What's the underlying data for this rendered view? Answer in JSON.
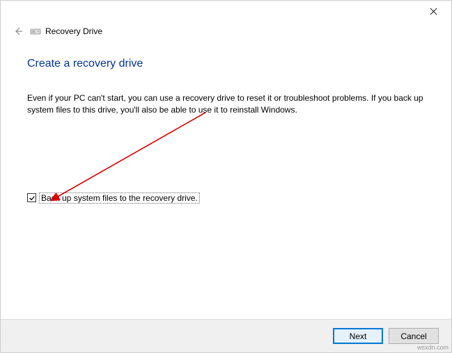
{
  "titlebar": {
    "close_label": "Close"
  },
  "header": {
    "window_title": "Recovery Drive"
  },
  "wizard": {
    "heading": "Create a recovery drive",
    "description": "Even if your PC can't start, you can use a recovery drive to reset it or troubleshoot problems. If you back up system files to this drive, you'll also be able to use it to reinstall Windows.",
    "checkbox_label": "Back up system files to the recovery drive.",
    "checkbox_checked": true
  },
  "buttons": {
    "next": "Next",
    "cancel": "Cancel"
  },
  "watermark": "wsxdn.com"
}
